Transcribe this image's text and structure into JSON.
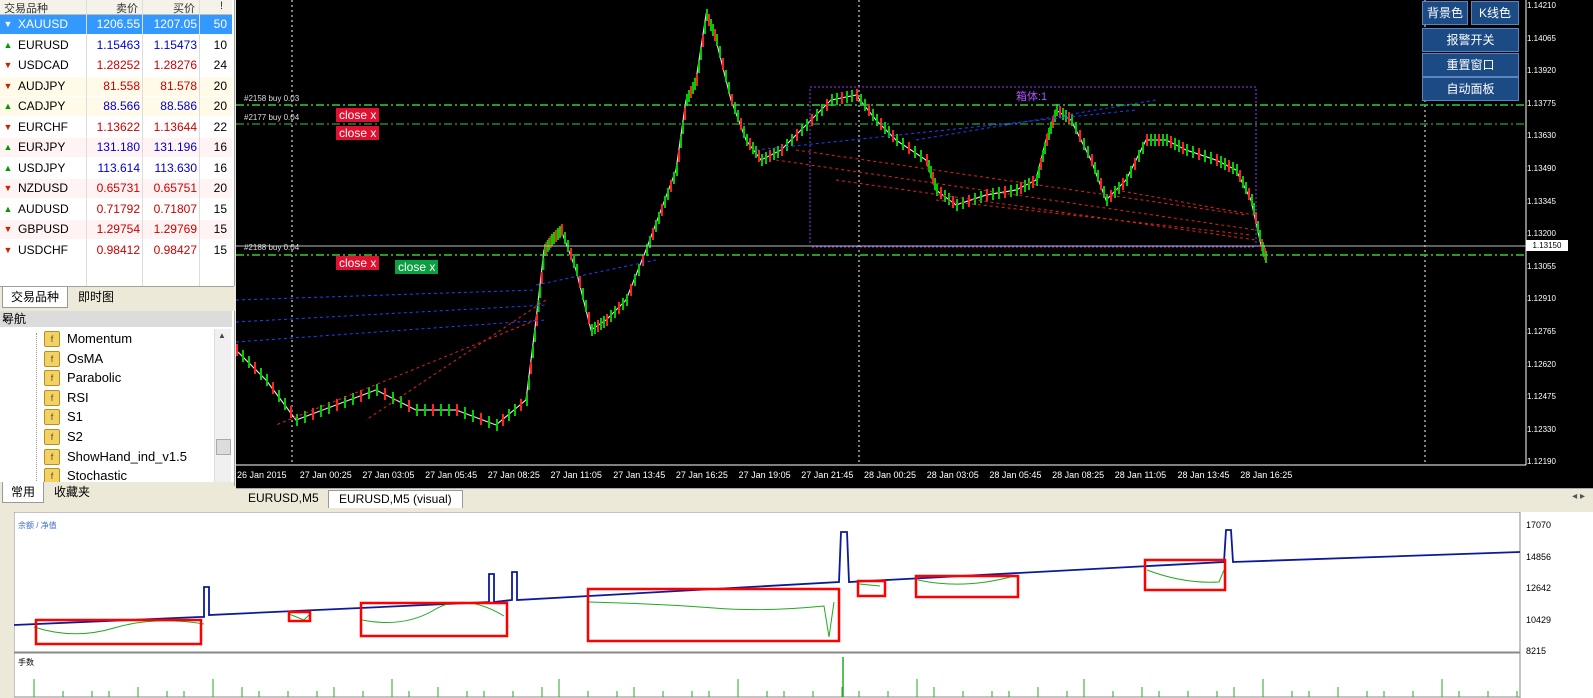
{
  "market_watch": {
    "headers": {
      "symbol": "交易品种",
      "bid": "卖价",
      "ask": "买价",
      "spread": "!"
    },
    "rows": [
      {
        "symbol": "XAUUSD",
        "bid": "1206.55",
        "ask": "1207.05",
        "spread": "50",
        "dir": "down",
        "color": "red"
      },
      {
        "symbol": "EURUSD",
        "bid": "1.15463",
        "ask": "1.15473",
        "spread": "10",
        "dir": "up",
        "color": "blue"
      },
      {
        "symbol": "USDCAD",
        "bid": "1.28252",
        "ask": "1.28276",
        "spread": "24",
        "dir": "down",
        "color": "red"
      },
      {
        "symbol": "AUDJPY",
        "bid": "81.558",
        "ask": "81.578",
        "spread": "20",
        "dir": "down",
        "color": "red"
      },
      {
        "symbol": "CADJPY",
        "bid": "88.566",
        "ask": "88.586",
        "spread": "20",
        "dir": "up",
        "color": "blue"
      },
      {
        "symbol": "EURCHF",
        "bid": "1.13622",
        "ask": "1.13644",
        "spread": "22",
        "dir": "down",
        "color": "red"
      },
      {
        "symbol": "EURJPY",
        "bid": "131.180",
        "ask": "131.196",
        "spread": "16",
        "dir": "up",
        "color": "blue"
      },
      {
        "symbol": "USDJPY",
        "bid": "113.614",
        "ask": "113.630",
        "spread": "16",
        "dir": "up",
        "color": "blue"
      },
      {
        "symbol": "NZDUSD",
        "bid": "0.65731",
        "ask": "0.65751",
        "spread": "20",
        "dir": "down",
        "color": "red"
      },
      {
        "symbol": "AUDUSD",
        "bid": "0.71792",
        "ask": "0.71807",
        "spread": "15",
        "dir": "up",
        "color": "red"
      },
      {
        "symbol": "GBPUSD",
        "bid": "1.29754",
        "ask": "1.29769",
        "spread": "15",
        "dir": "down",
        "color": "red"
      },
      {
        "symbol": "USDCHF",
        "bid": "0.98412",
        "ask": "0.98427",
        "spread": "15",
        "dir": "down",
        "color": "red"
      }
    ],
    "tabs": [
      "交易品种",
      "即时图"
    ]
  },
  "navigator": {
    "title": "导航",
    "close": "×",
    "items": [
      "Momentum",
      "OsMA",
      "Parabolic",
      "RSI",
      "S1",
      "S2",
      "ShowHand_ind_v1.5",
      "Stochastic"
    ],
    "tabs": [
      "常用",
      "收藏夹"
    ]
  },
  "chart": {
    "buttons": {
      "bg": "背景色",
      "kcolor": "K线色",
      "alert": "报警开关",
      "reset": "重置窗口",
      "auto": "自动面板"
    },
    "close_buttons": [
      "close x",
      "close x",
      "close x",
      "close x"
    ],
    "order_labels": [
      "#2158 buy 0.03",
      "#2177 buy 0.04",
      "#2188 buy 0.04"
    ],
    "box_label": "箱体:1",
    "price_axis": [
      "1.14210",
      "1.14065",
      "1.13920",
      "1.13775",
      "1.13630",
      "1.13490",
      "1.13345",
      "1.13200",
      "1.13055",
      "1.12910",
      "1.12765",
      "1.12620",
      "1.12475",
      "1.12330",
      "1.12190"
    ],
    "current_price": "1.13150",
    "time_axis": [
      "26 Jan 2015",
      "27 Jan 00:25",
      "27 Jan 03:05",
      "27 Jan 05:45",
      "27 Jan 08:25",
      "27 Jan 11:05",
      "27 Jan 13:45",
      "27 Jan 16:25",
      "27 Jan 19:05",
      "27 Jan 21:45",
      "28 Jan 00:25",
      "28 Jan 03:05",
      "28 Jan 05:45",
      "28 Jan 08:25",
      "28 Jan 11:05",
      "28 Jan 13:45",
      "28 Jan 16:25"
    ],
    "colors": {
      "bg": "#000000",
      "bull": "#00cc00",
      "bear": "#ff2020",
      "grid": "#ffffff",
      "tp": "#33cc33",
      "box": "#9933ff"
    }
  },
  "chart_tabs": [
    "EURUSD,M5",
    "EURUSD,M5 (visual)"
  ],
  "equity": {
    "title": "余额 / 净值",
    "lots_title": "手数",
    "axis": [
      "17070",
      "14856",
      "12642",
      "10429",
      "8215"
    ],
    "colors": {
      "balance": "#0a1a9a",
      "equity": "#22aa22",
      "box": "#ff0000",
      "lots": "#22aa22"
    }
  }
}
